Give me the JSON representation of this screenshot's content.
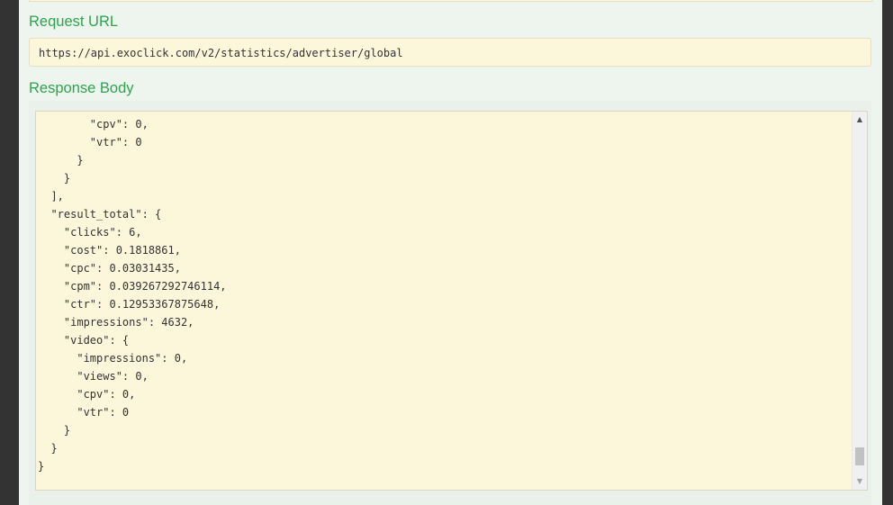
{
  "request_url": {
    "heading": "Request URL",
    "value": "https://api.exoclick.com/v2/statistics/advertiser/global"
  },
  "response_body": {
    "heading": "Response Body",
    "lines": [
      "        \"cpv\": 0,",
      "        \"vtr\": 0",
      "      }",
      "    }",
      "  ],",
      "  \"result_total\": {",
      "    \"clicks\": 6,",
      "    \"cost\": 0.1818861,",
      "    \"cpc\": 0.03031435,",
      "    \"cpm\": 0.039267292746114,",
      "    \"ctr\": 0.12953367875648,",
      "    \"impressions\": 4632,",
      "    \"video\": {",
      "      \"impressions\": 0,",
      "      \"views\": 0,",
      "      \"cpv\": 0,",
      "      \"vtr\": 0",
      "    }",
      "  }",
      "}"
    ]
  },
  "scrollbar": {
    "up_glyph": "▲",
    "down_glyph": "▼",
    "position_fraction": 0.97
  }
}
